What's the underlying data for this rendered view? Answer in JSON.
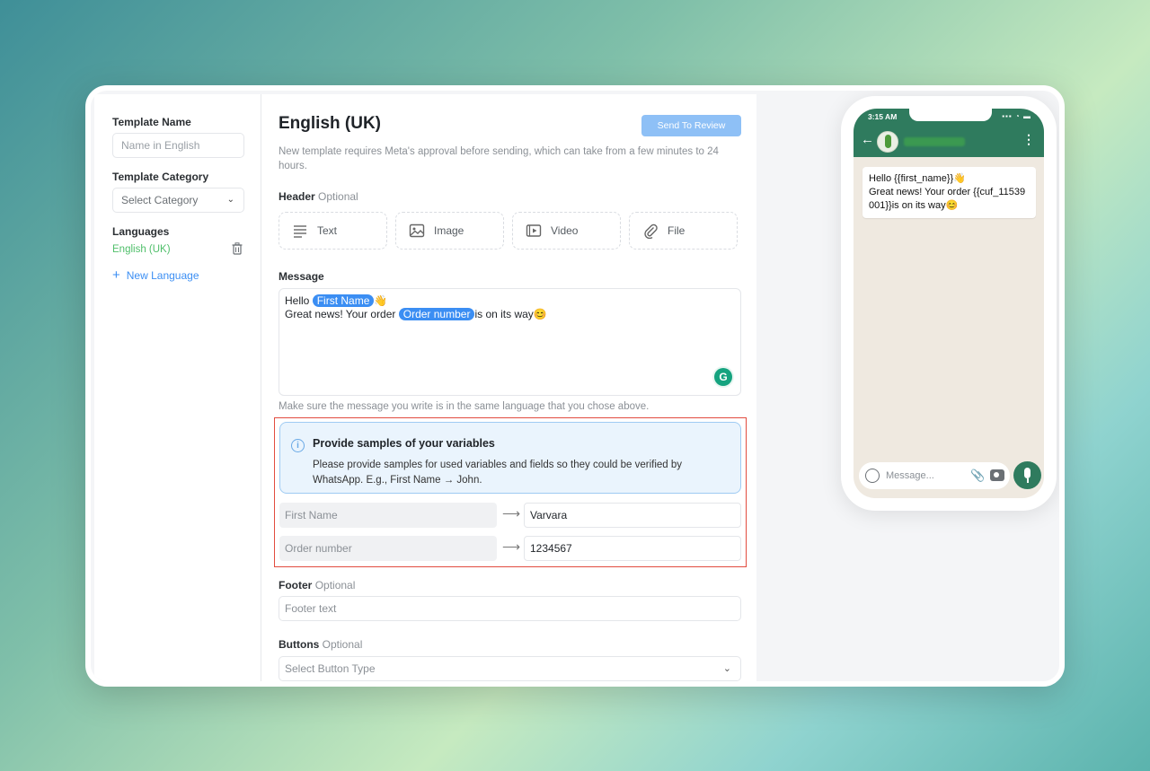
{
  "sidebar": {
    "template_name_label": "Template Name",
    "template_name_placeholder": "Name in English",
    "template_category_label": "Template Category",
    "template_category_value": "Select Category",
    "languages_label": "Languages",
    "language_item": "English (UK)",
    "new_language": "New Language"
  },
  "main": {
    "title": "English (UK)",
    "review_button": "Send To Review",
    "approval_note": "New template requires Meta's approval before sending, which can take from a few minutes to 24 hours.",
    "header_label": "Header",
    "optional": "Optional",
    "header_options": [
      "Text",
      "Image",
      "Video",
      "File"
    ],
    "message_label": "Message",
    "message_line1_prefix": "Hello",
    "message_var1": "First Name",
    "message_line2_prefix": "Great news! Your order",
    "message_var2": "Order number",
    "message_line2_suffix": "is on its way😊",
    "grammarly": "G",
    "language_hint": "Make sure the message you write is in the same language that you chose above.",
    "samples_title": "Provide samples of your variables",
    "samples_text": "Please provide samples for used variables and fields so they could be verified by WhatsApp. E.g., First Name → John.",
    "variables": [
      {
        "key": "First Name",
        "value": "Varvara"
      },
      {
        "key": "Order number",
        "value": "1234567"
      }
    ],
    "footer_label": "Footer",
    "footer_placeholder": "Footer text",
    "buttons_label": "Buttons",
    "buttons_placeholder": "Select Button Type"
  },
  "phone": {
    "time": "3:15 AM",
    "bubble_line1": "Hello {{first_name}}👋",
    "bubble_line2": "Great news! Your order {{cuf_11539001}}is on its way😊",
    "composer_placeholder": "Message..."
  },
  "colors": {
    "accent": "#3b8ef3",
    "whatsapp_green": "#2f7b5e",
    "highlight_border": "#e24c3f"
  }
}
